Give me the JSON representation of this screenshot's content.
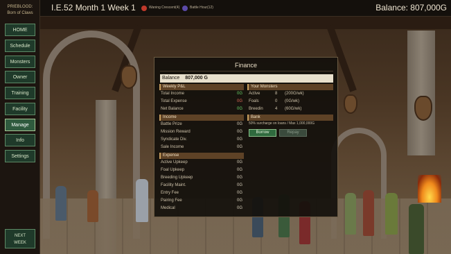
{
  "sidebar": {
    "brand_line1": "PRIEBLOOD:",
    "brand_line2": "Born of Claws",
    "items": [
      {
        "label": "HOME",
        "active": false
      },
      {
        "label": "Schedule",
        "active": false
      },
      {
        "label": "Monsters",
        "active": false
      },
      {
        "label": "Owner",
        "active": false
      },
      {
        "label": "Training",
        "active": false
      },
      {
        "label": "Facility",
        "active": false
      },
      {
        "label": "Manage",
        "active": true
      },
      {
        "label": "Info",
        "active": false
      },
      {
        "label": "Settings",
        "active": false
      }
    ],
    "next_week_line1": "NEXT",
    "next_week_line2": "WEEK"
  },
  "topbar": {
    "date": "I.E.52 Month 1 Week 1",
    "moon1": {
      "label": "Waning Crescent(4)",
      "color": "#c0392b"
    },
    "moon2": {
      "label": "Battle Hour(12)",
      "color": "#5b4aa8"
    },
    "balance": "Balance: 807,000G"
  },
  "finance": {
    "title": "Finance",
    "balance_label": "Balance",
    "balance_value": "807,000 G",
    "weekly_pl": {
      "header": "Weekly P&L",
      "rows": [
        {
          "label": "Total Income",
          "value": "0G"
        },
        {
          "label": "Total Expense",
          "value": "0G"
        },
        {
          "label": "Net Balance",
          "value": "0G"
        }
      ]
    },
    "income": {
      "header": "Income",
      "rows": [
        {
          "label": "Battle Prize",
          "value": "0G"
        },
        {
          "label": "Mission Reward",
          "value": "0G"
        },
        {
          "label": "Syndicate Div.",
          "value": "0G"
        },
        {
          "label": "Sale Income",
          "value": "0G"
        }
      ]
    },
    "expense": {
      "header": "Expense",
      "rows": [
        {
          "label": "Active Upkeep",
          "value": "0G"
        },
        {
          "label": "Foal Upkeep",
          "value": "0G"
        },
        {
          "label": "Breeding Upkeep",
          "value": "0G"
        },
        {
          "label": "Facility Maint.",
          "value": "0G"
        },
        {
          "label": "Entry Fee",
          "value": "0G"
        },
        {
          "label": "Pairing Fee",
          "value": "0G"
        },
        {
          "label": "Medical",
          "value": "0G"
        }
      ]
    },
    "your_monsters": {
      "header": "Your Monsters",
      "rows": [
        {
          "label": "Active",
          "count": "8",
          "cost": "(200G/wk)"
        },
        {
          "label": "Foals",
          "count": "0",
          "cost": "(0G/wk)"
        },
        {
          "label": "Breedin",
          "count": "4",
          "cost": "(60G/wk)"
        }
      ]
    },
    "bank": {
      "header": "Bank",
      "note": "50% surcharge on loans / Max 1,000,000G",
      "borrow_label": "Borrow",
      "repay_label": "Repay"
    }
  }
}
